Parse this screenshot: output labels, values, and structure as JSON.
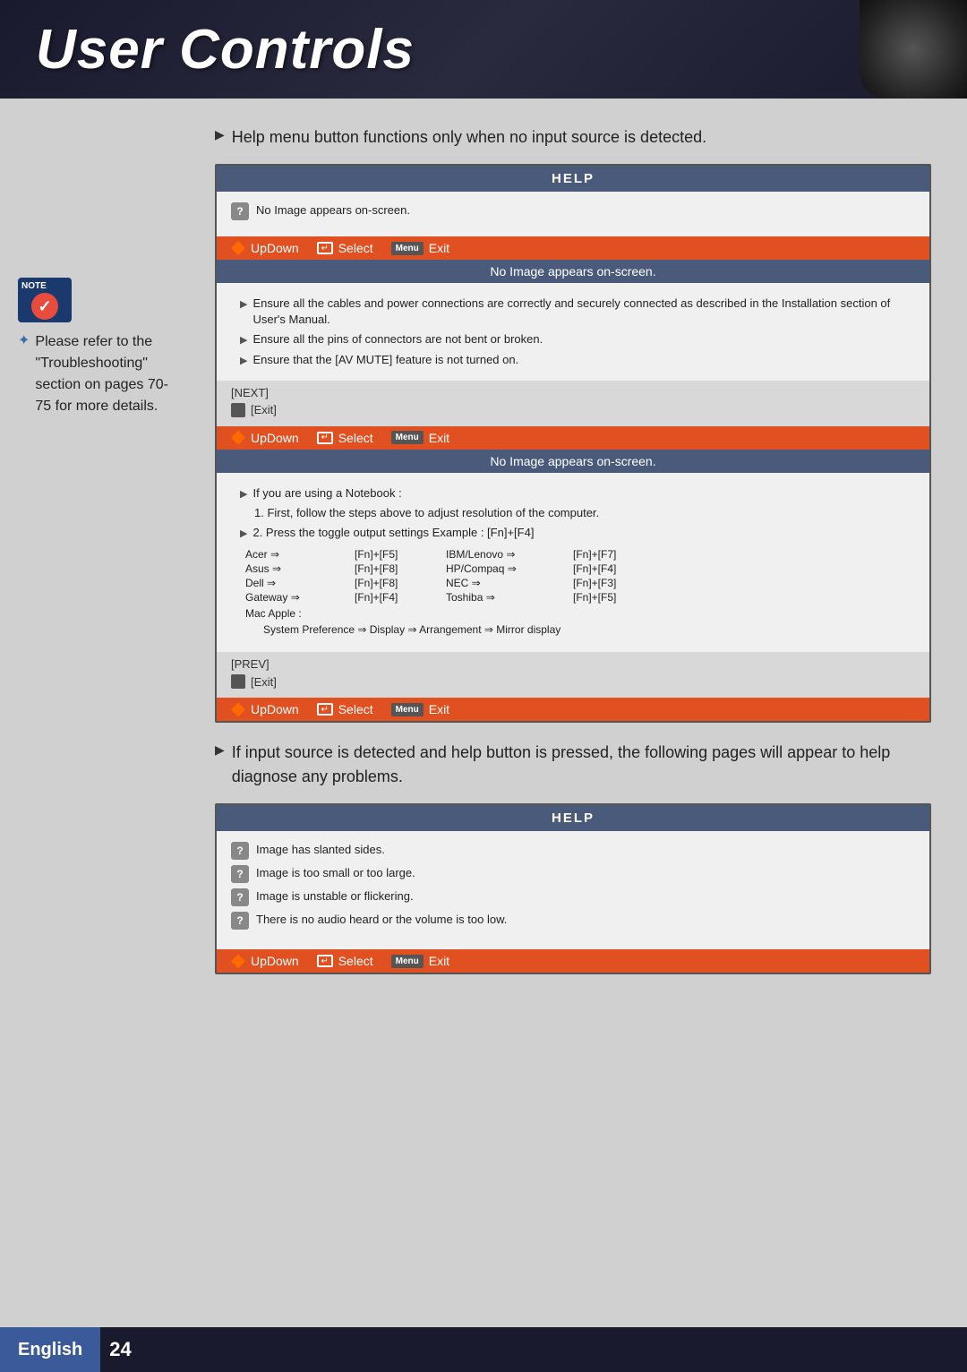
{
  "header": {
    "title": "User Controls"
  },
  "note": {
    "label": "NOTE",
    "text": "Please refer to the \"Troubleshooting\" section on pages 70-75 for more details."
  },
  "bullet1": {
    "text": "Help menu button functions only when no input source is detected."
  },
  "bullet2": {
    "text": "If input source is detected and help button is pressed, the following pages will appear to help diagnose any problems."
  },
  "help_screen_1": {
    "title": "HELP",
    "question": "No Image appears on-screen.",
    "nav": {
      "updown": "UpDown",
      "select": "Select",
      "exit": "Exit"
    },
    "status": "No Image appears on-screen.",
    "items": [
      "Ensure all the cables and power connections are correctly and securely connected as described in the Installation section of User's Manual.",
      "Ensure all the pins of connectors are not bent or broken.",
      "Ensure that the [AV MUTE] feature is not turned on."
    ],
    "next": "[NEXT]",
    "exit_label": "[Exit]"
  },
  "help_screen_2": {
    "title": "HELP",
    "nav": {
      "updown": "UpDown",
      "select": "Select",
      "exit": "Exit"
    },
    "status": "No Image appears on-screen.",
    "notebook_header": "If you are using a Notebook :",
    "step1": "1. First, follow the steps above to adjust resolution of the computer.",
    "step2": "2. Press the toggle output settings  Example : [Fn]+[F4]",
    "table": [
      {
        "brand": "Acer ⇒",
        "key": "[Fn]+[F5]",
        "brand2": "IBM/Lenovo ⇒",
        "key2": "[Fn]+[F7]"
      },
      {
        "brand": "Asus ⇒",
        "key": "[Fn]+[F8]",
        "brand2": "HP/Compaq ⇒",
        "key2": "[Fn]+[F4]"
      },
      {
        "brand": "Dell ⇒",
        "key": "[Fn]+[F8]",
        "brand2": "NEC ⇒",
        "key2": "[Fn]+[F3]"
      },
      {
        "brand": "Gateway ⇒",
        "key": "[Fn]+[F4]",
        "brand2": "Toshiba ⇒",
        "key2": "[Fn]+[F5]"
      }
    ],
    "mac_label": "Mac Apple :",
    "mac_path": "System Preference ⇒ Display ⇒ Arrangement ⇒ Mirror display",
    "prev": "[PREV]",
    "exit_label": "[Exit]"
  },
  "help_screen_3": {
    "title": "HELP",
    "questions": [
      "Image has slanted sides.",
      "Image is too small or too large.",
      "Image is unstable or flickering.",
      "There is no audio heard or the volume is too low."
    ],
    "nav": {
      "updown": "UpDown",
      "select": "Select",
      "exit": "Exit"
    }
  },
  "footer": {
    "language": "English",
    "page": "24"
  }
}
